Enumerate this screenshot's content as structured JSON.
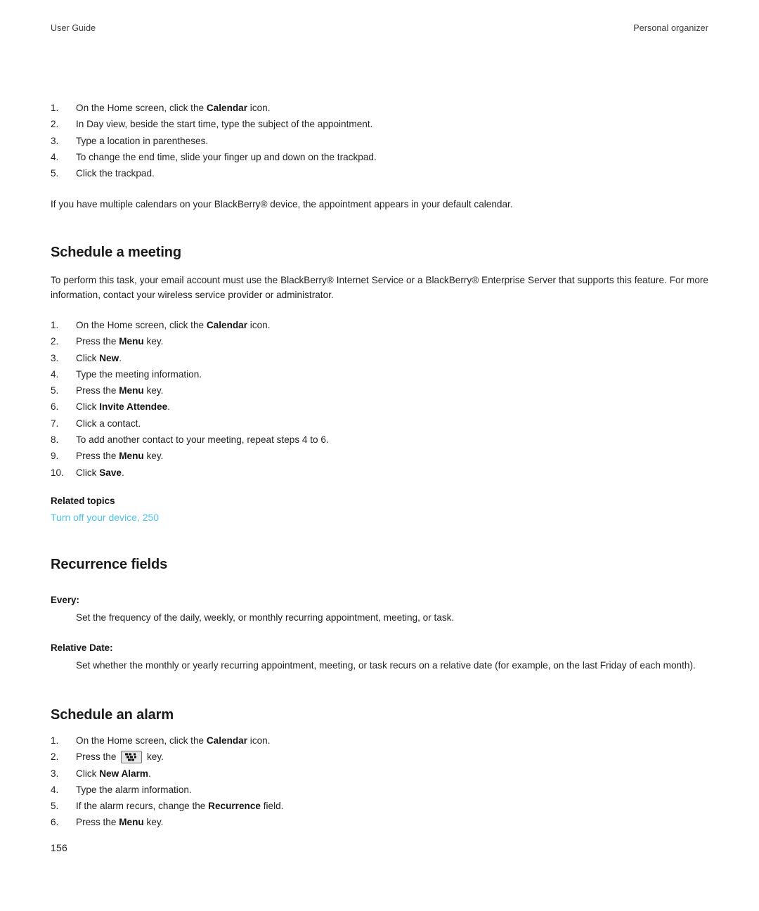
{
  "running_head": {
    "left": "User Guide",
    "right": "Personal organizer"
  },
  "colors": {
    "text": "#231f20",
    "heading": "#1a1a1a",
    "link": "#4cc3ec",
    "page_background": "#ffffff",
    "key_icon_face": "#e8e8e8",
    "key_icon_border": "#6e6e6e"
  },
  "appointment_steps": {
    "items": [
      {
        "num": "1.",
        "text_before": "On the Home screen, click the ",
        "bold": "Calendar",
        "text_after": " icon."
      },
      {
        "num": "2.",
        "text_before": "In Day view, beside the start time, type the subject of the appointment.",
        "bold": "",
        "text_after": ""
      },
      {
        "num": "3.",
        "text_before": "Type a location in parentheses.",
        "bold": "",
        "text_after": ""
      },
      {
        "num": "4.",
        "text_before": "To change the end time, slide your finger up and down on the trackpad.",
        "bold": "",
        "text_after": ""
      },
      {
        "num": "5.",
        "text_before": "Click the trackpad.",
        "bold": "",
        "text_after": ""
      }
    ],
    "note": "If you have multiple calendars on your BlackBerry® device, the appointment appears in your default calendar."
  },
  "schedule_meeting": {
    "title": "Schedule a meeting",
    "intro": "To perform this task, your email account must use the BlackBerry® Internet Service or a BlackBerry® Enterprise Server that supports this feature. For more information, contact your wireless service provider or administrator.",
    "steps": [
      {
        "num": "1.",
        "text_before": "On the Home screen, click the ",
        "bold": "Calendar",
        "text_after": " icon."
      },
      {
        "num": "2.",
        "text_before": "Press the ",
        "bold": "Menu",
        "text_after": " key."
      },
      {
        "num": "3.",
        "text_before": "Click ",
        "bold": "New",
        "text_after": "."
      },
      {
        "num": "4.",
        "text_before": "Type the meeting information.",
        "bold": "",
        "text_after": ""
      },
      {
        "num": "5.",
        "text_before": "Press the ",
        "bold": "Menu",
        "text_after": " key."
      },
      {
        "num": "6.",
        "text_before": "Click ",
        "bold": "Invite Attendee",
        "text_after": "."
      },
      {
        "num": "7.",
        "text_before": "Click a contact.",
        "bold": "",
        "text_after": ""
      },
      {
        "num": "8.",
        "text_before": "To add another contact to your meeting, repeat steps 4 to 6.",
        "bold": "",
        "text_after": ""
      },
      {
        "num": "9.",
        "text_before": "Press the ",
        "bold": "Menu",
        "text_after": " key."
      },
      {
        "num": "10.",
        "text_before": "Click ",
        "bold": "Save",
        "text_after": "."
      }
    ],
    "related_topics_label": "Related topics",
    "related_topics_link": "Turn off your device, 250"
  },
  "recurrence_fields": {
    "title": "Recurrence fields",
    "definitions": [
      {
        "term": "Every:",
        "description": "Set the frequency of the daily, weekly, or monthly recurring appointment, meeting, or task."
      },
      {
        "term": "Relative Date:",
        "description": "Set whether the monthly or yearly recurring appointment, meeting, or task recurs on a relative date (for example, on the last Friday of each month)."
      }
    ]
  },
  "schedule_alarm": {
    "title": "Schedule an alarm",
    "steps": [
      {
        "num": "1.",
        "text_before": "On the Home screen, click the ",
        "bold": "Calendar",
        "text_after": " icon.",
        "icon": ""
      },
      {
        "num": "2.",
        "text_before": "Press the ",
        "bold": "",
        "text_after": " key.",
        "icon": "blackberry-menu-key-icon"
      },
      {
        "num": "3.",
        "text_before": "Click ",
        "bold": "New Alarm",
        "text_after": ".",
        "icon": ""
      },
      {
        "num": "4.",
        "text_before": "Type the alarm information.",
        "bold": "",
        "text_after": "",
        "icon": ""
      },
      {
        "num": "5.",
        "text_before": "If the alarm recurs, change the ",
        "bold": "Recurrence",
        "text_after": " field.",
        "icon": ""
      },
      {
        "num": "6.",
        "text_before": "Press the ",
        "bold": "Menu",
        "text_after": " key.",
        "icon": ""
      }
    ]
  },
  "folio": "156"
}
